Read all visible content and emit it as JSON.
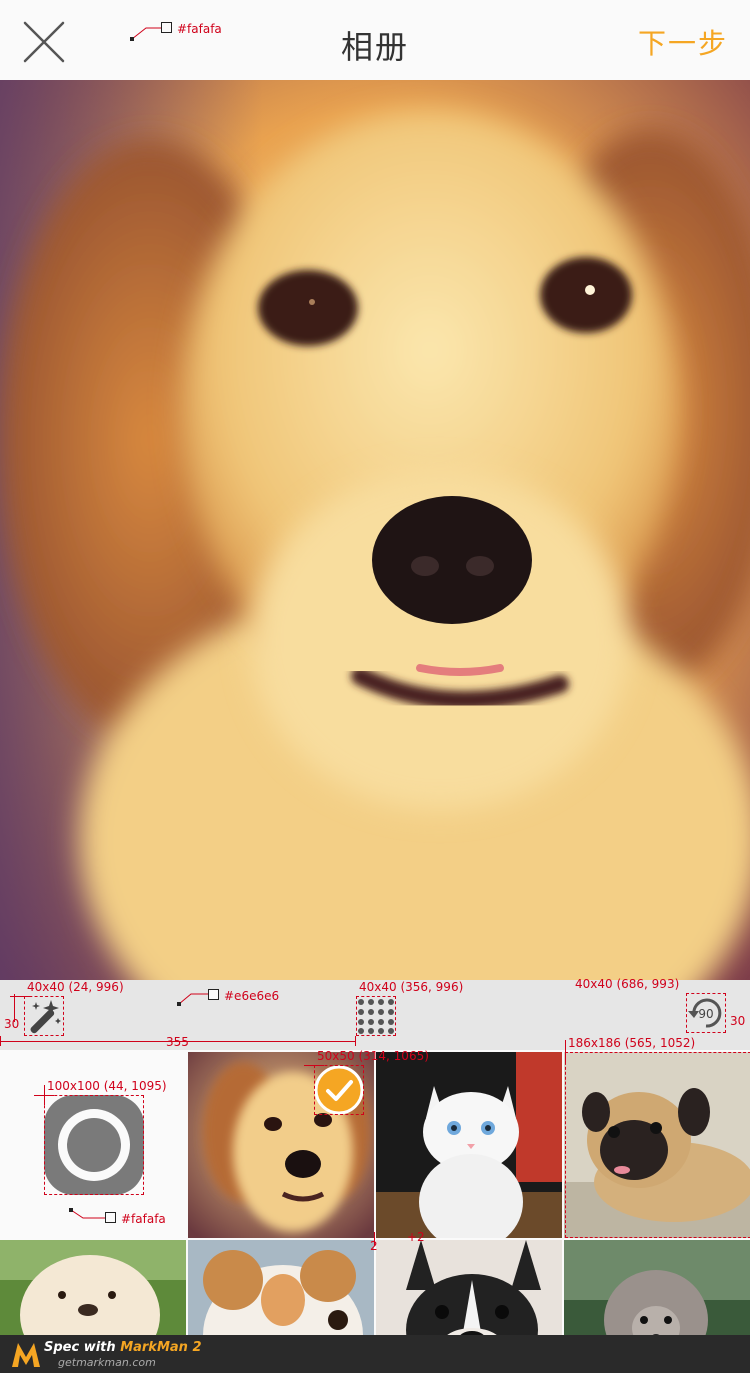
{
  "header": {
    "title": "相册",
    "next_label": "下一步",
    "close_icon": "close-icon"
  },
  "colors": {
    "accent": "#f5a623",
    "header_bg": "#fafafa",
    "toolbar_bg": "#e6e6e6",
    "annotation": "#d0021b"
  },
  "toolbar": {
    "tools": [
      {
        "name": "magic-wand-icon"
      },
      {
        "name": "grid-dots-icon"
      },
      {
        "name": "rotate-icon",
        "label": "90"
      }
    ]
  },
  "grid": {
    "cells": [
      {
        "name": "camera-capture-button",
        "icon": "shutter-icon"
      },
      {
        "name": "photo-golden-dog",
        "selected": true
      },
      {
        "name": "photo-white-kitten",
        "selected": false
      },
      {
        "name": "photo-pug",
        "selected": false
      },
      {
        "name": "photo-chow-puppy",
        "selected": false
      },
      {
        "name": "photo-jack-russell",
        "selected": false
      },
      {
        "name": "photo-french-bulldog",
        "selected": false
      },
      {
        "name": "photo-grey-poodle",
        "selected": false
      }
    ]
  },
  "annotations": {
    "header_color": "#fafafa",
    "toolbar_color": "#e6e6e6",
    "camera_bg_color": "#fafafa",
    "wand_spec": "40x40 (24, 996)",
    "dots_spec": "40x40 (356, 996)",
    "rotate_spec": "40x40 (686, 993)",
    "left_margin": "30",
    "right_margin": "30",
    "span_width": "355",
    "check_spec": "50x50 (314, 1065)",
    "photo_spec": "186x186 (565, 1052)",
    "shutter_spec": "100x100 (44, 1095)",
    "gap_a": "2",
    "gap_b": "+2"
  },
  "footer": {
    "spec_prefix": "Spec with ",
    "brand": "MarkMan 2",
    "url": "getmarkman.com"
  }
}
